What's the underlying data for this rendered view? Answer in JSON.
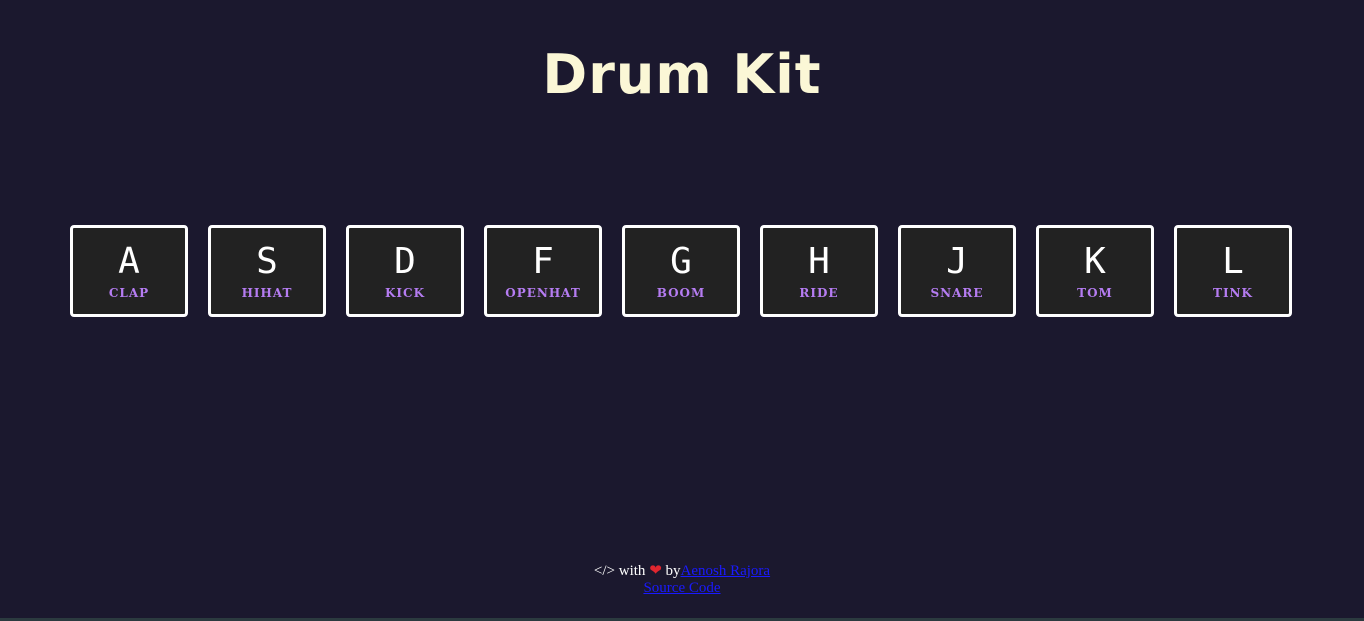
{
  "title": "Drum Kit",
  "keys": [
    {
      "letter": "A",
      "sound": "CLAP"
    },
    {
      "letter": "S",
      "sound": "HIHAT"
    },
    {
      "letter": "D",
      "sound": "KICK"
    },
    {
      "letter": "F",
      "sound": "OPENHAT"
    },
    {
      "letter": "G",
      "sound": "BOOM"
    },
    {
      "letter": "H",
      "sound": "RIDE"
    },
    {
      "letter": "J",
      "sound": "SNARE"
    },
    {
      "letter": "K",
      "sound": "TOM"
    },
    {
      "letter": "L",
      "sound": "TINK"
    }
  ],
  "footer": {
    "code_symbol": "</>",
    "with_text": "with",
    "heart": "❤",
    "by_text": "by",
    "author_link": "Aenosh Rajora",
    "source_link": "Source Code"
  },
  "colors": {
    "background": "#1b182e",
    "title": "#fbf7d6",
    "key_background": "#222222",
    "key_border": "#ffffff",
    "sound_label": "#b57cf2",
    "link": "#1a1aff",
    "heart": "#e0262f"
  }
}
